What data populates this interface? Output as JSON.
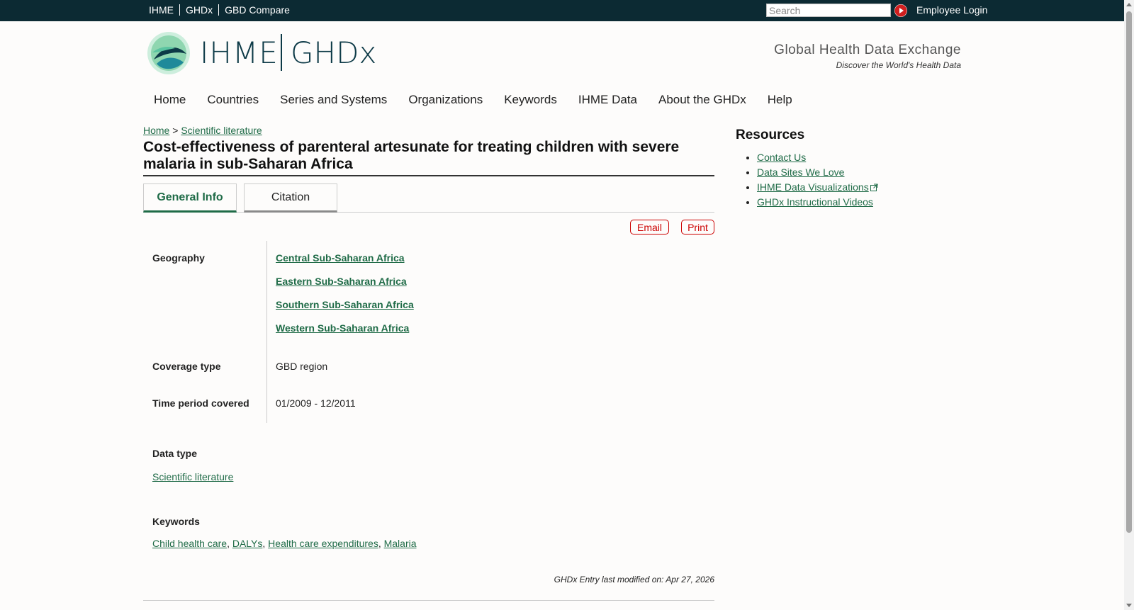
{
  "topbar": {
    "links": [
      "IHME",
      "GHDx",
      "GBD Compare"
    ],
    "search_placeholder": "Search",
    "employee_login": "Employee Login"
  },
  "header": {
    "logo_ihme": "IHME",
    "logo_ghdx": "GHDx",
    "tagline_title": "Global Health Data Exchange",
    "tagline_sub": "Discover the World's Health Data"
  },
  "nav": {
    "items": [
      "Home",
      "Countries",
      "Series and Systems",
      "Organizations",
      "Keywords",
      "IHME Data",
      "About the GHDx",
      "Help"
    ]
  },
  "breadcrumb": {
    "home": "Home",
    "sep": ">",
    "current": "Scientific literature"
  },
  "page": {
    "title": "Cost-effectiveness of parenteral artesunate for treating children with severe malaria in sub-Saharan Africa",
    "tabs": [
      "General Info",
      "Citation"
    ],
    "email_label": "Email",
    "print_label": "Print"
  },
  "details": {
    "geography_label": "Geography",
    "geography": [
      "Central Sub-Saharan Africa",
      "Eastern Sub-Saharan Africa",
      "Southern Sub-Saharan Africa",
      "Western Sub-Saharan Africa"
    ],
    "coverage_label": "Coverage type",
    "coverage_value": "GBD region",
    "time_label": "Time period covered",
    "time_value": "01/2009 - 12/2011",
    "datatype_label": "Data type",
    "datatype_value": "Scientific literature",
    "keywords_label": "Keywords",
    "keywords": [
      "Child health care",
      "DALYs",
      "Health care expenditures",
      "Malaria"
    ],
    "comma": ",",
    "modified": "GHDx Entry last modified on: Apr 27, 2026"
  },
  "sidebar": {
    "title": "Resources",
    "links": [
      "Contact Us",
      "Data Sites We Love",
      "IHME Data Visualizations",
      "GHDx Instructional Videos"
    ]
  },
  "colors": {
    "topbar": "#0c2a33",
    "link": "#1f6b47",
    "accent_red": "#cc0000"
  },
  "icons": {
    "go": "play-circle-icon",
    "external": "external-link-icon"
  }
}
